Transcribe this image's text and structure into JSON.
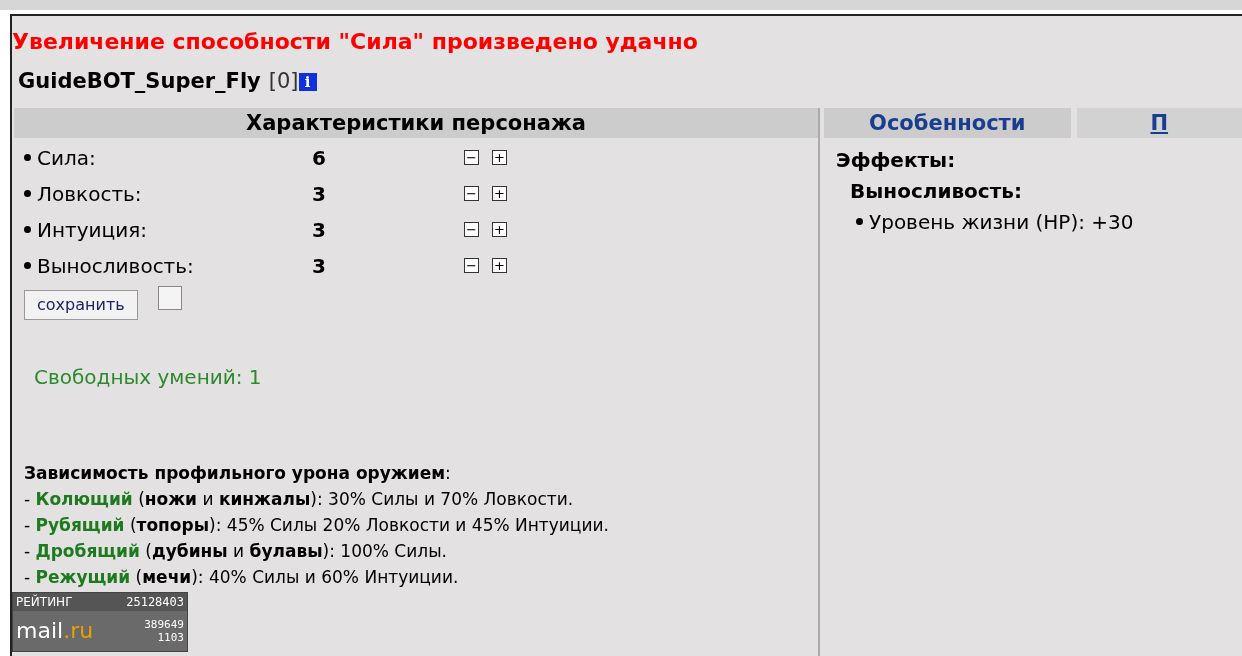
{
  "message": "Увеличение способности \"Сила\" произведено удачно",
  "character": {
    "name": "GuideBOT_Super_Fly",
    "level": "[0]",
    "info_icon": "i"
  },
  "stats_panel": {
    "title": "Характеристики персонажа",
    "stats": [
      {
        "label": "Сила:",
        "value": "6",
        "minus": "−",
        "plus": "+"
      },
      {
        "label": "Ловкость:",
        "value": "3",
        "minus": "−",
        "plus": "+"
      },
      {
        "label": "Интуиция:",
        "value": "3",
        "minus": "−",
        "plus": "+"
      },
      {
        "label": "Выносливость:",
        "value": "3",
        "minus": "−",
        "plus": "+"
      }
    ],
    "save_button": "сохранить",
    "save_checkbox": {
      "checked": false
    },
    "free_skills": "Свободных умений: 1",
    "damage_heading": "**Зависимость профильного урона оружием**:",
    "damage_lines": [
      {
        "prefix": "-",
        "weapon": "Колющий",
        "detail": "(**ножи** и **кинжалы**): 30% Силы и 70% Ловкости."
      },
      {
        "prefix": "-",
        "weapon": "Рубящий",
        "detail": "(**топоры**): 45% Силы 20% Ловкости и 45% Интуиции."
      },
      {
        "prefix": "-",
        "weapon": "Дробящий",
        "detail": "(**дубины** и **булавы**): 100% Силы."
      },
      {
        "prefix": "-",
        "weapon": "Режущий",
        "detail": "(**мечи**): 40% Силы и 60% Интуиции."
      }
    ]
  },
  "tabs": [
    {
      "label": "Особенности",
      "selected": true
    },
    {
      "label": "П",
      "selected": false
    }
  ],
  "features": {
    "heading": "Эффекты:",
    "subheading": "Выносливость:",
    "items": [
      "Уровень жизни (HP): +30"
    ]
  },
  "counter": {
    "label": "РЕЙТИНГ",
    "rank": "25128403",
    "logo_main": "mail",
    "logo_suffix": ".ru",
    "hits": "389649",
    "hosts": "1103"
  }
}
